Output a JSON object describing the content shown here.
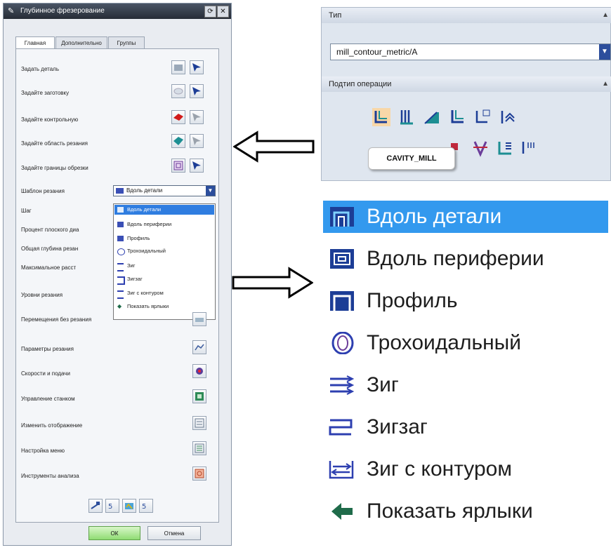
{
  "dialog": {
    "title": "Глубинное фрезерование",
    "tabs": [
      "Главная",
      "Дополнительно",
      "Группы"
    ],
    "rows": [
      {
        "label": "Задать деталь"
      },
      {
        "label": "Задайте заготовку"
      },
      {
        "label": "Задайте контрольную"
      },
      {
        "label": "Задайте область резания"
      },
      {
        "label": "Задайте границы обрезки"
      },
      {
        "label": "Шаблон резания"
      },
      {
        "label": "Шаг"
      },
      {
        "label": "Процент плоского диа"
      },
      {
        "label": "Общая глубина резан"
      },
      {
        "label": "Максимальное расст"
      },
      {
        "label": "Уровни резания"
      },
      {
        "label": "Перемещения без резания"
      },
      {
        "label": "Параметры резания"
      },
      {
        "label": "Скорости и подачи"
      },
      {
        "label": "Управление станком"
      },
      {
        "label": "Изменить отображение"
      },
      {
        "label": "Настройка меню"
      },
      {
        "label": "Инструменты анализа"
      }
    ],
    "pattern_value": "Вдоль детали",
    "dropdown_items": [
      "Вдоль детали",
      "Вдоль периферии",
      "Профиль",
      "Трохоидальный",
      "Зиг",
      "Зигзаг",
      "Зиг с контуром",
      "Показать ярлыки"
    ],
    "ok_label": "ОК",
    "cancel_label": "Отмена"
  },
  "type_panel": {
    "type_header": "Тип",
    "type_value": "mill_contour_metric/A",
    "subtype_header": "Подтип операции",
    "tooltip": "CAVITY_MILL"
  },
  "big_list": [
    "Вдоль детали",
    "Вдоль периферии",
    "Профиль",
    "Трохоидальный",
    "Зиг",
    "Зигзаг",
    "Зиг с контуром",
    "Показать ярлыки"
  ],
  "colors": {
    "accent": "#3399ee",
    "dropdown_selected": "#2f7de0",
    "icon_blue": "#2c4e9c",
    "shortcut_arrow": "#1f6b4a"
  }
}
